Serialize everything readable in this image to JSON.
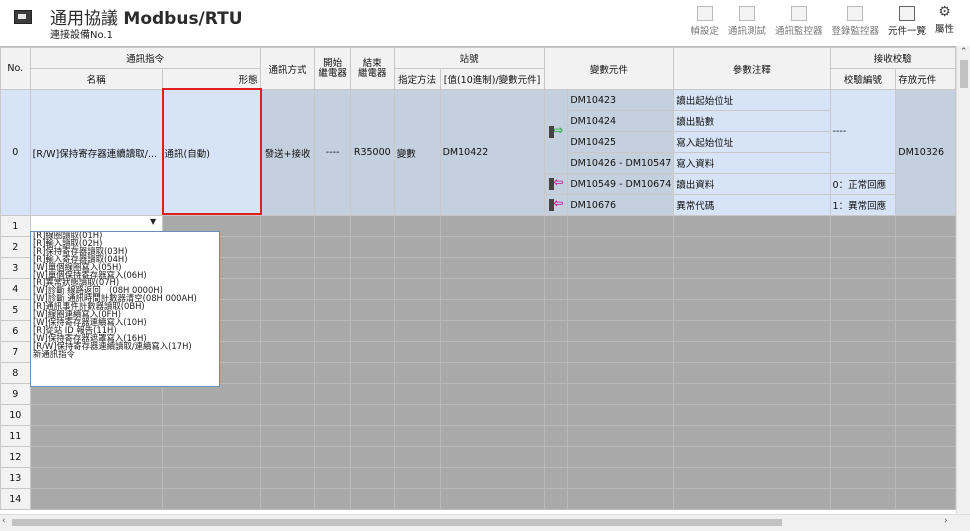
{
  "window": {
    "title_prefix": "通用協議 ",
    "title_main": "Modbus/RTU",
    "subtitle": "連接設備No.1"
  },
  "toolbar": [
    {
      "label": "幀設定",
      "icon": "frame-settings-icon"
    },
    {
      "label": "通訊測試",
      "icon": "comm-test-icon"
    },
    {
      "label": "通訊監控器",
      "icon": "comm-monitor-icon"
    },
    {
      "label": "登錄監控器",
      "icon": "register-monitor-icon"
    },
    {
      "label": "元件一覽",
      "icon": "device-list-icon"
    },
    {
      "label": "屬性",
      "icon": "gear-icon"
    }
  ],
  "headers": {
    "no": "No.",
    "comm_cmd": "通訊指令",
    "name": "名稱",
    "form": "形態",
    "comm_mode": "通訊方式",
    "start_relay": "開始\n繼電器",
    "end_relay": "結束\n繼電器",
    "station": "站號",
    "spec_method": "指定方法",
    "station_value": "[值(10進制)/變數元件]",
    "var_device": "變數元件",
    "param_note": "參數注釋",
    "recv_check": "接收校驗",
    "check_num": "校驗編號",
    "store_device": "存放元件"
  },
  "row0": {
    "no": "0",
    "name": "[R/W]保持寄存器連續讀取/...",
    "form": "通訊(自動)",
    "comm_mode": "發送+接收",
    "start_relay": "----",
    "end_relay": "R35000",
    "spec_method": "變數",
    "station_value": "DM10422",
    "params": [
      {
        "device": "DM10423",
        "note": "讀出起始位址",
        "check": ""
      },
      {
        "device": "DM10424",
        "note": "讀出點數",
        "check": ""
      },
      {
        "device": "DM10425",
        "note": "寫入起始位址",
        "check": ""
      },
      {
        "device": "DM10426 - DM10547",
        "note": "寫入資料",
        "check": ""
      },
      {
        "device": "DM10549 - DM10674",
        "note": "讀出資料",
        "check": "0：正常回應"
      },
      {
        "device": "DM10676",
        "note": "異常代碼",
        "check": "1：異常回應"
      }
    ],
    "check_dash": "----",
    "store_device": "DM10326"
  },
  "row_numbers": [
    "1",
    "2",
    "3",
    "4",
    "5",
    "6",
    "7",
    "8",
    "9",
    "10",
    "11",
    "12",
    "13",
    "14"
  ],
  "dropdown": [
    "[R]線圈讀取(01H)",
    "[R]輸入讀取(02H)",
    "[R]保持寄存器讀取(03H)",
    "[R]輸入寄存器讀取(04H)",
    "[W]單個線圈寫入(05H)",
    "[W]單個保持寄存器寫入(06H)",
    "[R]異常狀態讀取(07H)",
    "[W]診斷 線路返回　(08H 0000H)",
    "[W]診斷 通訊時間計數器清空(08H 000AH)",
    "[R]通訊事件計數器讀取(0BH)",
    "[W]線圈連續寫入(0FH)",
    "[W]保持寄存器連續寫入(10H)",
    "[R]從站 ID 報告(11H)",
    "[W]保持寄存器遮罩寫入(16H)",
    "[R/W]保持寄存器連續讀取/連續寫入(17H)",
    "新通訊指令"
  ],
  "colors": {
    "selected_row": "#d7e4f7",
    "empty_cell": "#a9a9a9",
    "highlight_box": "#e31d1d"
  }
}
